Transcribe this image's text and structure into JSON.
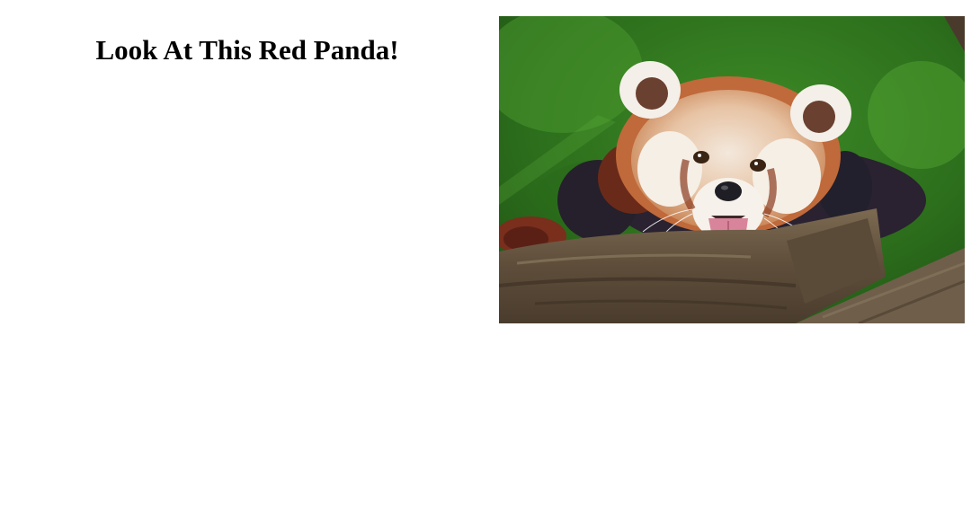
{
  "page": {
    "heading": "Look At This Red Panda!"
  },
  "photo": {
    "subject": "red-panda",
    "colors": {
      "background_green": "#2f7a1e",
      "fur_orange": "#c8683a",
      "fur_white": "#f2ede4",
      "fur_dark": "#2a2230",
      "bark": "#6b5a45",
      "tongue": "#d8849a"
    }
  }
}
